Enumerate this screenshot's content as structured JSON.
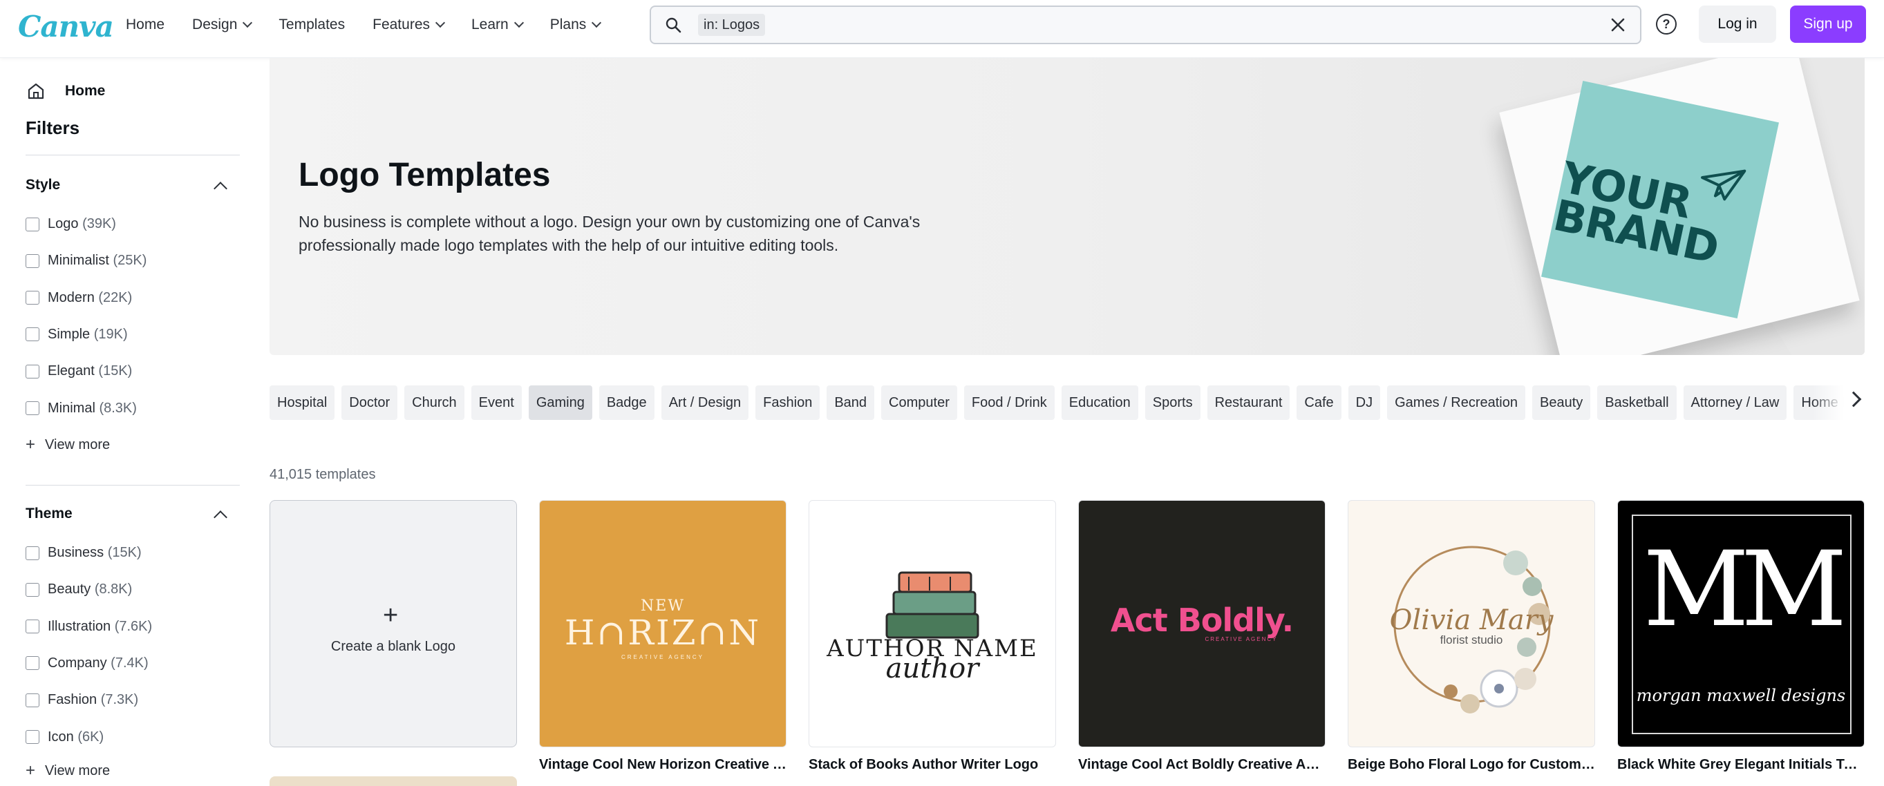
{
  "header": {
    "logo": "Canva",
    "nav": [
      {
        "label": "Home",
        "has_menu": false
      },
      {
        "label": "Design",
        "has_menu": true
      },
      {
        "label": "Templates",
        "has_menu": false
      },
      {
        "label": "Features",
        "has_menu": true
      },
      {
        "label": "Learn",
        "has_menu": true
      },
      {
        "label": "Plans",
        "has_menu": true
      }
    ],
    "search": {
      "chip": "in: Logos",
      "value": "",
      "placeholder": ""
    },
    "help": "?",
    "login": "Log in",
    "signup": "Sign up",
    "accent": "#8b3dff"
  },
  "sidebar": {
    "home": "Home",
    "filters": "Filters",
    "style": {
      "title": "Style",
      "items": [
        {
          "label": "Logo",
          "count": "(39K)"
        },
        {
          "label": "Minimalist",
          "count": "(25K)"
        },
        {
          "label": "Modern",
          "count": "(22K)"
        },
        {
          "label": "Simple",
          "count": "(19K)"
        },
        {
          "label": "Elegant",
          "count": "(15K)"
        },
        {
          "label": "Minimal",
          "count": "(8.3K)"
        }
      ],
      "view_more": "View more"
    },
    "theme": {
      "title": "Theme",
      "items": [
        {
          "label": "Business",
          "count": "(15K)"
        },
        {
          "label": "Beauty",
          "count": "(8.8K)"
        },
        {
          "label": "Illustration",
          "count": "(7.6K)"
        },
        {
          "label": "Company",
          "count": "(7.4K)"
        },
        {
          "label": "Fashion",
          "count": "(7.3K)"
        },
        {
          "label": "Icon",
          "count": "(6K)"
        }
      ],
      "view_more": "View more"
    }
  },
  "hero": {
    "title": "Logo Templates",
    "description": "No business is complete without a logo. Design your own by customizing one of Canva's professionally made logo templates with the help of our intuitive editing tools.",
    "image_text": "YOUR BRAND"
  },
  "chips": [
    "Hospital",
    "Doctor",
    "Church",
    "Event",
    "Gaming",
    "Badge",
    "Art / Design",
    "Fashion",
    "Band",
    "Computer",
    "Food / Drink",
    "Education",
    "Sports",
    "Restaurant",
    "Cafe",
    "DJ",
    "Games / Recreation",
    "Beauty",
    "Basketball",
    "Attorney / Law",
    "Home F"
  ],
  "active_chip": "Gaming",
  "results": {
    "count": "41,015 templates",
    "blank_label": "Create a blank Logo",
    "templates": [
      {
        "title": "Vintage Cool New Horizon Creative Ag...",
        "bg": "#dfa042",
        "art": "horizon",
        "text_main": "H∩RIZ∩N",
        "text_top": "NEW",
        "text_sub": "CREATIVE AGENCY"
      },
      {
        "title": "Stack of Books Author Writer Logo",
        "bg": "#ffffff",
        "art": "books",
        "text_main": "AUTHOR NAME",
        "text_sub": "author"
      },
      {
        "title": "Vintage Cool Act Boldly Creative Age...",
        "bg": "#22221e",
        "art": "boldly",
        "text_main": "Act Boldly.",
        "text_sub": "CREATIVE AGENCY"
      },
      {
        "title": "Beige Boho Floral Logo for Custom Fl...",
        "bg": "#fbf6ef",
        "art": "floral",
        "text_main": "Olivia Mary",
        "text_sub": "florist studio"
      },
      {
        "title": "Black White Grey Elegant Initials Typo...",
        "bg": "#000000",
        "art": "initials",
        "text_main": "MM",
        "text_sub": "morgan maxwell designs"
      }
    ]
  }
}
